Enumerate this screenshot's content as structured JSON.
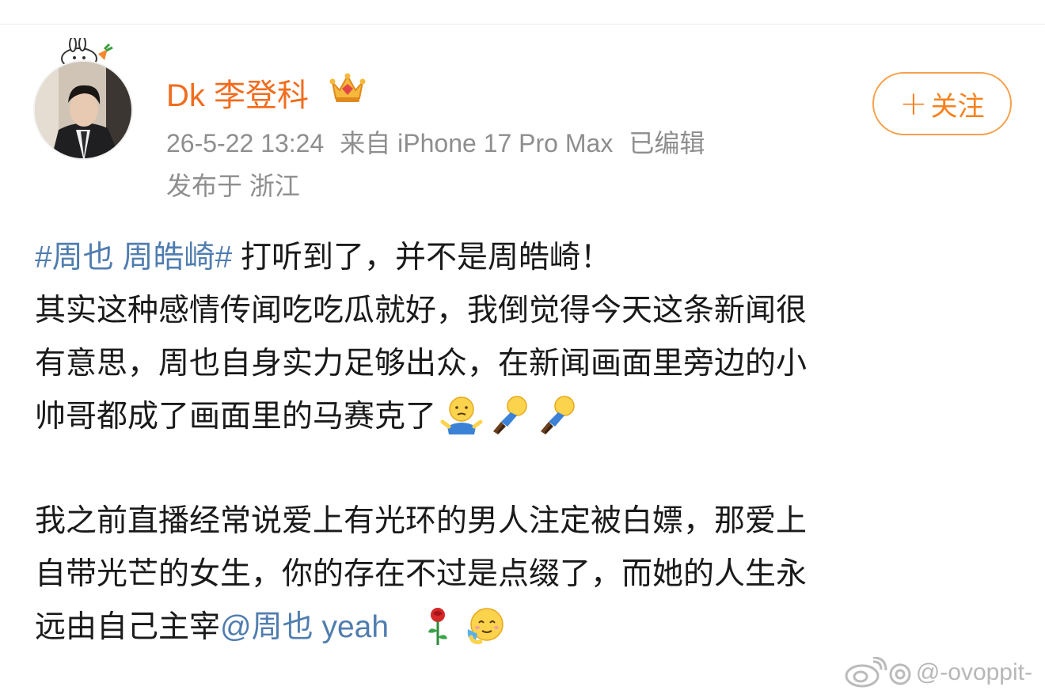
{
  "post": {
    "author": "Dk 李登科",
    "timestamp": "26-5-22 13:24",
    "source": "来自 iPhone 17 Pro Max",
    "edited": "已编辑",
    "location": "发布于 浙江",
    "follow_label": "关注",
    "follow_plus": "+",
    "hashtag": "#周也 周皓崎#",
    "line1_rest": " 打听到了，并不是周皓崎！",
    "line2": "其实这种感情传闻吃吃瓜就好，我倒觉得今天这条新闻很",
    "line3": "有意思，周也自身实力足够出众，在新闻画面里旁边的小",
    "line4": "帅哥都成了画面里的马赛克了",
    "para2_line1": "我之前直播经常说爱上有光环的男人注定被白嫖，那爱上",
    "para2_line2": "自带光芒的女生，你的存在不过是点缀了，而她的人生永",
    "para2_line3": "远由自己主宰",
    "mention": "@周也 yeah",
    "emojis": [
      "shrug-emoji-icon",
      "kneel-emoji-icon",
      "kneel-emoji-icon",
      "rose-emoji-icon",
      "hug-emoji-icon"
    ]
  },
  "watermark": {
    "text": "@-ovoppit-"
  },
  "colors": {
    "username": "#f26c1d",
    "link": "#507daf",
    "meta": "#8e8e8e",
    "follow_border": "#f6a04c"
  }
}
